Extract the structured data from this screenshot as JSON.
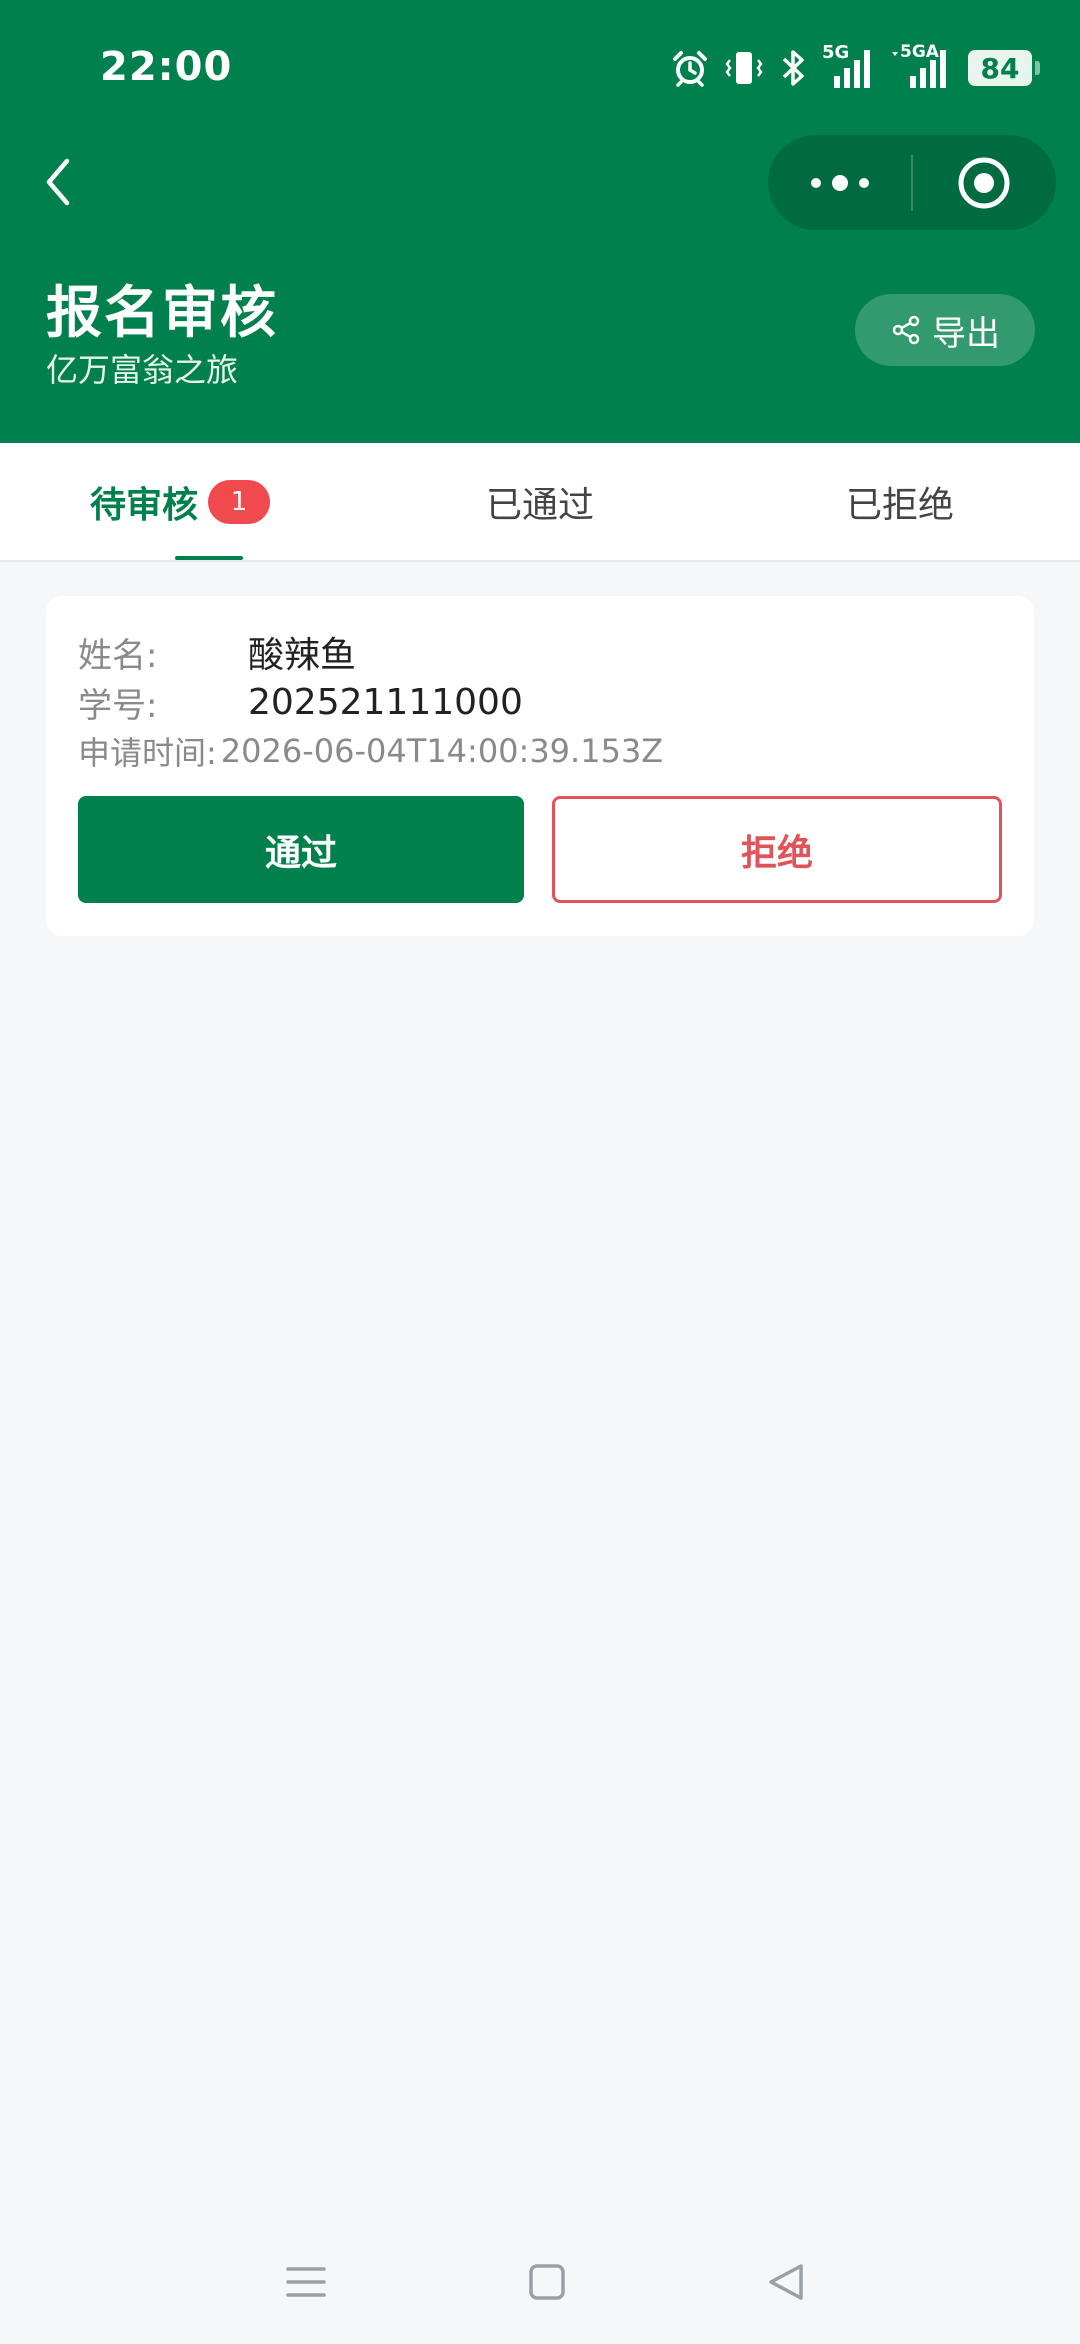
{
  "status_bar": {
    "time": "22:00",
    "network_5g": "5G",
    "network_5ga": "5GA",
    "battery": "84"
  },
  "header": {
    "title": "报名审核",
    "subtitle": "亿万富翁之旅",
    "export_label": "导出"
  },
  "tabs": [
    {
      "label": "待审核",
      "badge": "1",
      "active": true
    },
    {
      "label": "已通过",
      "active": false
    },
    {
      "label": "已拒绝",
      "active": false
    }
  ],
  "application": {
    "name_label": "姓名:",
    "name_value": "酸辣鱼",
    "student_id_label": "学号:",
    "student_id_value": "202521111000",
    "time_label": "申请时间:",
    "time_value": "2026-06-04T14:00:39.153Z",
    "approve_label": "通过",
    "reject_label": "拒绝"
  },
  "colors": {
    "brand_green": "#00804c",
    "reject_red": "#e05459",
    "badge_red": "#f04a4f"
  },
  "icons": {
    "back": "chevron-left-icon",
    "more": "more-dots-icon",
    "close_miniprogram": "target-circle-icon",
    "share": "share-icon",
    "alarm": "alarm-icon",
    "vibrate": "vibrate-icon",
    "bluetooth": "bluetooth-icon",
    "nav_menu": "menu-lines-icon",
    "nav_home": "home-square-icon",
    "nav_back": "back-triangle-icon"
  }
}
